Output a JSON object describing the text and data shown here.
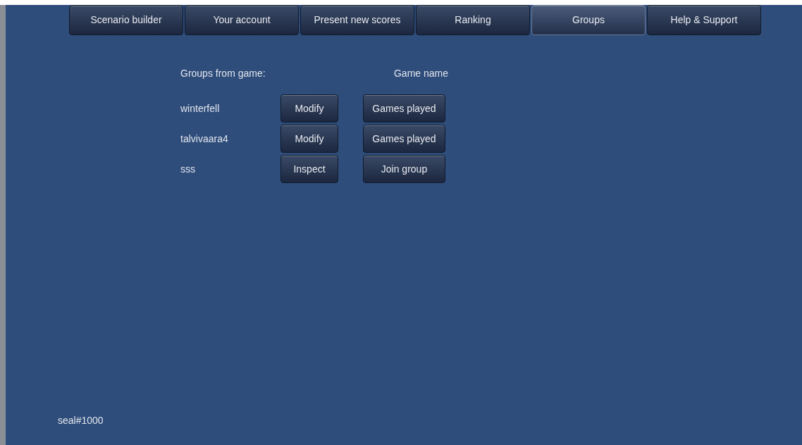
{
  "nav_tabs": [
    {
      "label": "Scenario builder",
      "selected": false
    },
    {
      "label": "Your account",
      "selected": false
    },
    {
      "label": "Present new scores",
      "selected": false
    },
    {
      "label": "Ranking",
      "selected": false
    },
    {
      "label": "Groups",
      "selected": true
    },
    {
      "label": "Help & Support",
      "selected": false
    }
  ],
  "groups": {
    "heading": "Groups from game:",
    "game_name_heading": "Game name",
    "rows": [
      {
        "name": "winterfell",
        "action": "Modify",
        "game_action": "Games played"
      },
      {
        "name": "talvivaara4",
        "action": "Modify",
        "game_action": "Games played"
      },
      {
        "name": "sss",
        "action": "Inspect",
        "game_action": "Join group"
      }
    ]
  },
  "footer": {
    "user": "seal#1000"
  }
}
